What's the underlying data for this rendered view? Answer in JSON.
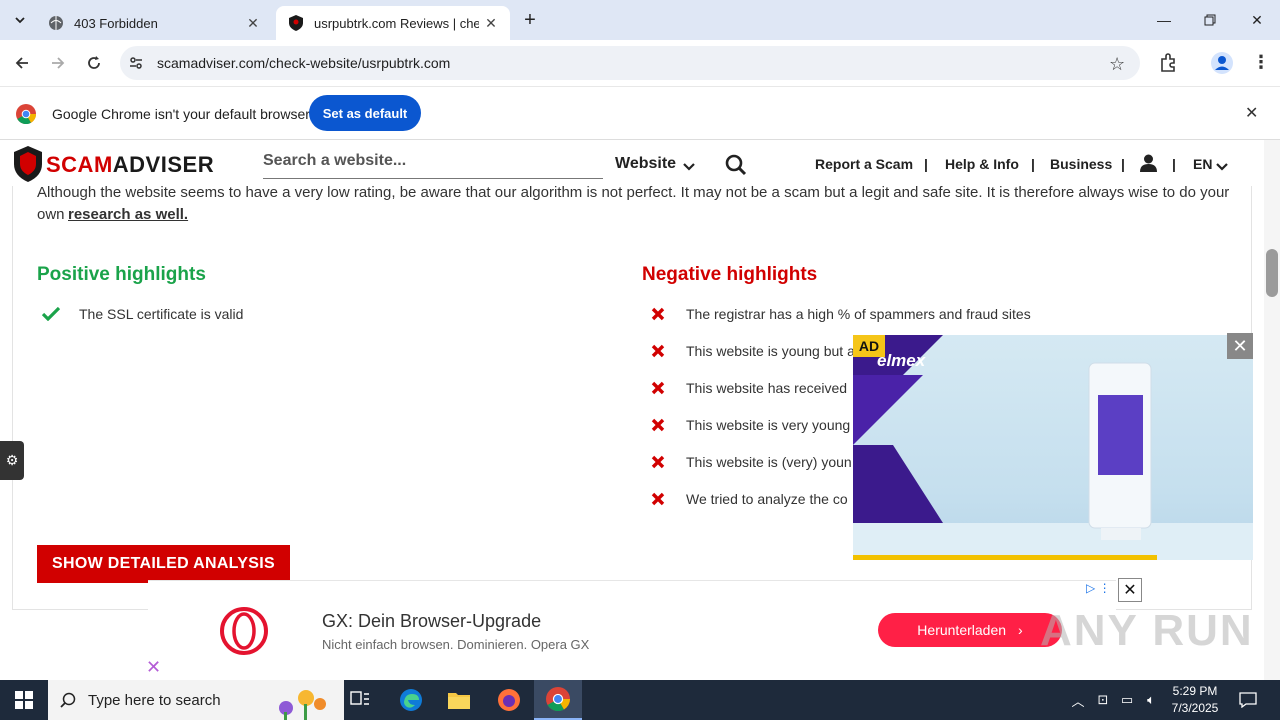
{
  "browser": {
    "tabs": [
      {
        "title": "403 Forbidden"
      },
      {
        "title": "usrpubtrk.com Reviews | check"
      }
    ],
    "new_tab": "+",
    "url": "scamadviser.com/check-website/usrpubtrk.com",
    "default_banner": {
      "message": "Google Chrome isn't your default browser",
      "button": "Set as default"
    }
  },
  "site": {
    "logo_scam": "SCAM",
    "logo_adviser": "ADVISER",
    "search_placeholder": "Search a website...",
    "search_type": "Website",
    "nav": {
      "report": "Report a Scam",
      "help": "Help & Info",
      "business": "Business",
      "lang": "EN"
    },
    "separator": "|"
  },
  "content": {
    "disclaimer": "Although the website seems to have a very low rating, be aware that our algorithm is not perfect. It may not be a scam but a legit and safe site. It is therefore always wise to do your",
    "disclaimer_own": "own",
    "disclaimer_link": "research as well.",
    "positive_title": "Positive highlights",
    "positive_items": [
      "The SSL certificate is valid"
    ],
    "negative_title": "Negative highlights",
    "negative_items": [
      "The registrar has a high % of spammers and fraud sites",
      "This website is young but a",
      "This website has received",
      "This website is very young",
      "This website is (very) youn",
      "We tried to analyze the co"
    ],
    "analysis_button": "SHOW DETAILED ANALYSIS",
    "colors": {
      "positive": "#1aa34a",
      "negative": "#d10000"
    }
  },
  "ad": {
    "label": "AD",
    "brand": "elmex",
    "close": "✕",
    "progress": 0.76
  },
  "bottom_ad": {
    "title": "GX: Dein Browser-Upgrade",
    "subtitle": "Nicht einfach browsen. Dominieren. Opera GX",
    "button": "Herunterladen",
    "close": "✕"
  },
  "watermark": "ANY RUN",
  "taskbar": {
    "search_placeholder": "Type here to search",
    "time": "5:29 PM",
    "date": "7/3/2025"
  }
}
